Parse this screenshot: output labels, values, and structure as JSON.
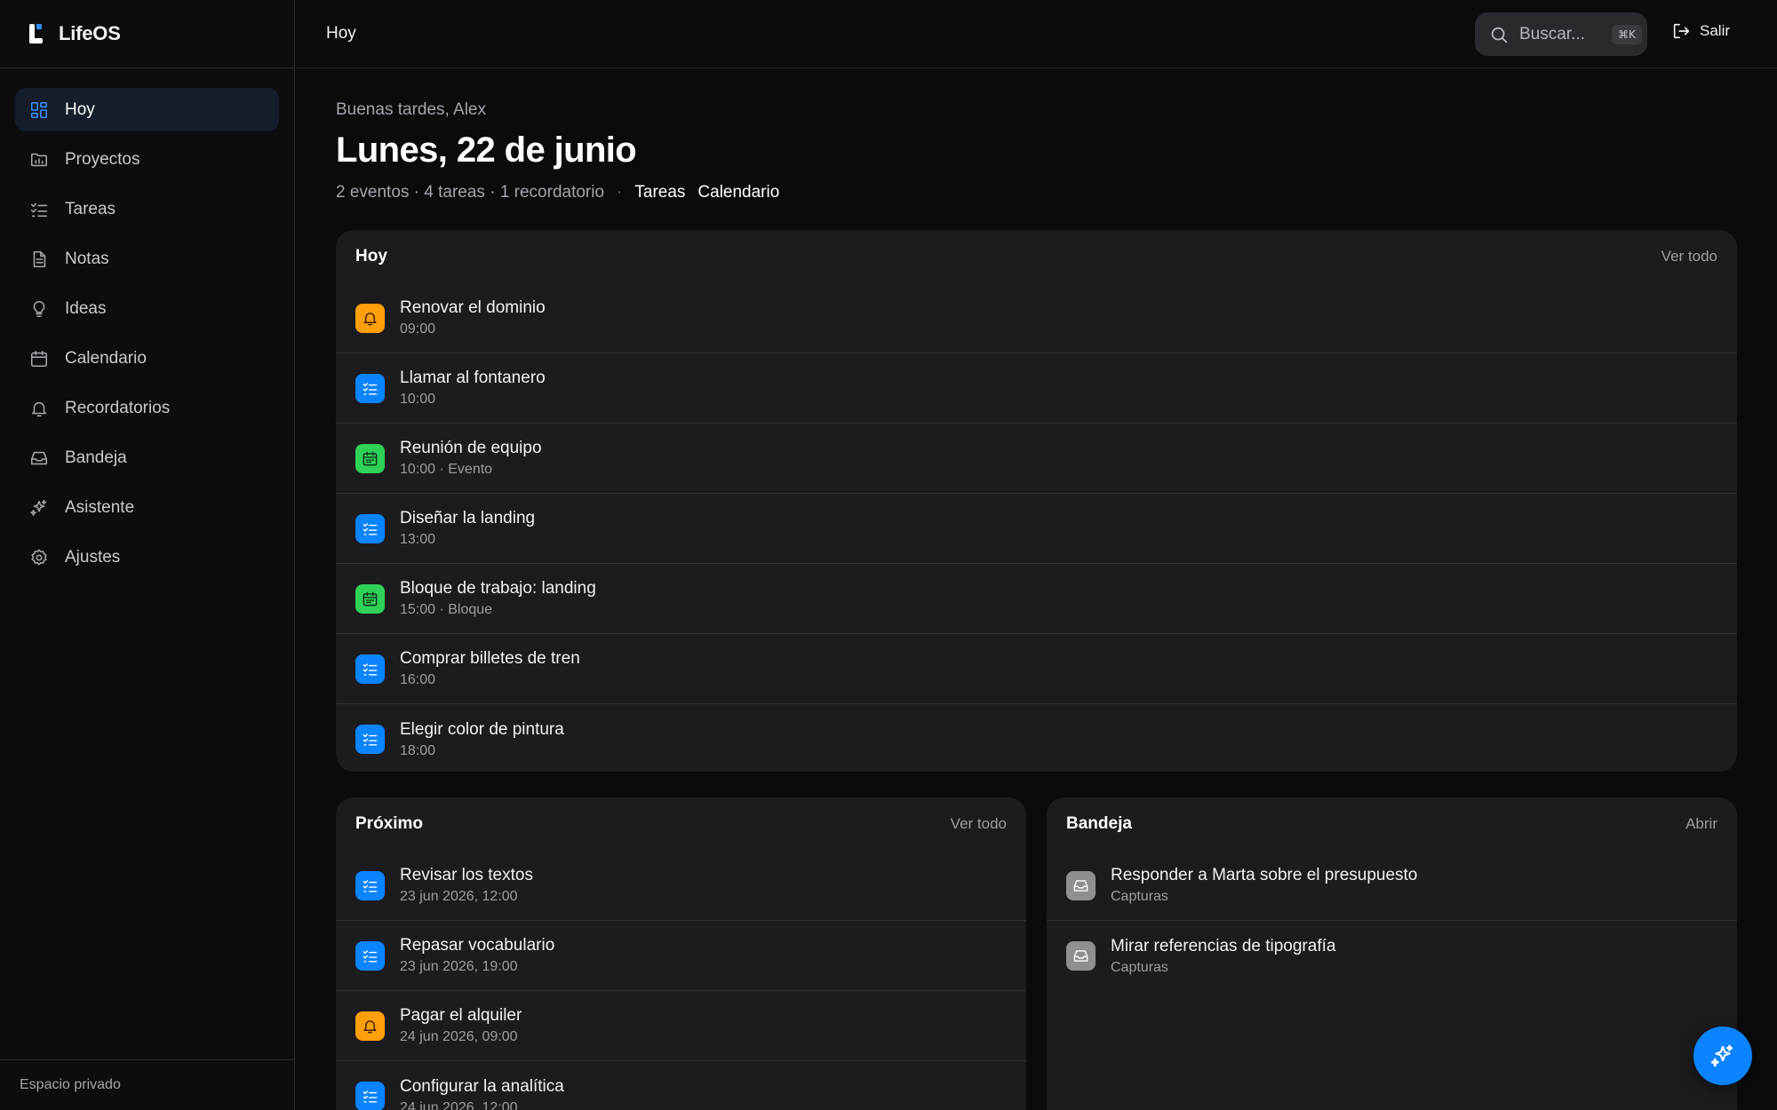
{
  "app": {
    "name": "LifeOS"
  },
  "sidebar": {
    "items": [
      {
        "label": "Hoy",
        "icon": "dashboard-icon",
        "active": true
      },
      {
        "label": "Proyectos",
        "icon": "folder-icon"
      },
      {
        "label": "Tareas",
        "icon": "checklist-icon"
      },
      {
        "label": "Notas",
        "icon": "document-icon"
      },
      {
        "label": "Ideas",
        "icon": "lightbulb-icon"
      },
      {
        "label": "Calendario",
        "icon": "calendar-icon"
      },
      {
        "label": "Recordatorios",
        "icon": "bell-icon"
      },
      {
        "label": "Bandeja",
        "icon": "inbox-icon"
      },
      {
        "label": "Asistente",
        "icon": "sparkles-icon"
      },
      {
        "label": "Ajustes",
        "icon": "gear-icon"
      }
    ],
    "footer": "Espacio privado"
  },
  "topbar": {
    "title": "Hoy",
    "search_placeholder": "Buscar...",
    "search_shortcut": "⌘K",
    "logout_label": "Salir"
  },
  "header": {
    "greeting": "Buenas tardes, Alex",
    "date": "Lunes, 22 de junio",
    "summary": "2 eventos · 4 tareas · 1 recordatorio",
    "links": [
      "Tareas",
      "Calendario"
    ]
  },
  "today": {
    "title": "Hoy",
    "link": "Ver todo",
    "items": [
      {
        "title": "Renovar el dominio",
        "sub": "09:00",
        "kind": "reminder"
      },
      {
        "title": "Llamar al fontanero",
        "sub": "10:00",
        "kind": "task"
      },
      {
        "title": "Reunión de equipo",
        "sub": "10:00 · Evento",
        "kind": "event"
      },
      {
        "title": "Diseñar la landing",
        "sub": "13:00",
        "kind": "task"
      },
      {
        "title": "Bloque de trabajo: landing",
        "sub": "15:00 · Bloque",
        "kind": "event"
      },
      {
        "title": "Comprar billetes de tren",
        "sub": "16:00",
        "kind": "task"
      },
      {
        "title": "Elegir color de pintura",
        "sub": "18:00",
        "kind": "task"
      }
    ]
  },
  "upcoming": {
    "title": "Próximo",
    "link": "Ver todo",
    "items": [
      {
        "title": "Revisar los textos",
        "sub": "23 jun 2026, 12:00",
        "kind": "task"
      },
      {
        "title": "Repasar vocabulario",
        "sub": "23 jun 2026, 19:00",
        "kind": "task"
      },
      {
        "title": "Pagar el alquiler",
        "sub": "24 jun 2026, 09:00",
        "kind": "reminder"
      },
      {
        "title": "Configurar la analítica",
        "sub": "24 jun 2026, 12:00",
        "kind": "task"
      }
    ]
  },
  "inbox": {
    "title": "Bandeja",
    "link": "Abrir",
    "items": [
      {
        "title": "Responder a Marta sobre el presupuesto",
        "sub": "Capturas",
        "kind": "inbox"
      },
      {
        "title": "Mirar referencias de tipografía",
        "sub": "Capturas",
        "kind": "inbox"
      }
    ]
  },
  "fab": {
    "icon": "sparkles-icon"
  },
  "colors": {
    "accent": "#0a84ff",
    "reminder": "#ff9f0a",
    "event": "#30d158",
    "inbox": "#8e8e93",
    "background": "#0b0b0c",
    "card": "#1c1c1e"
  }
}
